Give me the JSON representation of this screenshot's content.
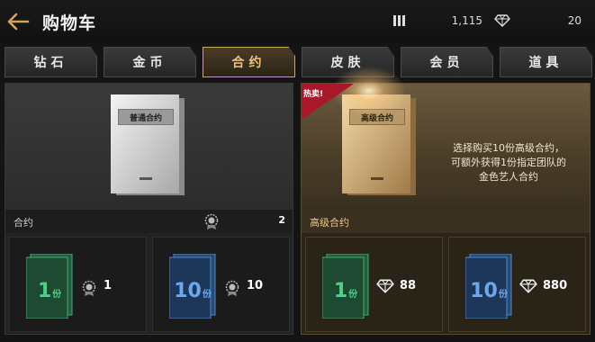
{
  "header": {
    "title": "购物车",
    "currency1_value": "1,115",
    "currency2_value": "20"
  },
  "tabs": [
    {
      "label": "钻石",
      "active": false
    },
    {
      "label": "金币",
      "active": false
    },
    {
      "label": "合约",
      "active": true
    },
    {
      "label": "皮肤",
      "active": false
    },
    {
      "label": "会员",
      "active": false
    },
    {
      "label": "道具",
      "active": false
    }
  ],
  "left_panel": {
    "card_label": "普通合约",
    "info_name": "合约",
    "owned_count": "2",
    "offers": [
      {
        "quantity": "1",
        "unit": "份",
        "price": "1",
        "currency": "medal-icon"
      },
      {
        "quantity": "10",
        "unit": "份",
        "price": "10",
        "currency": "medal-icon"
      }
    ]
  },
  "right_panel": {
    "badge": "热卖!",
    "card_label": "高级合约",
    "description": "选择购买10份高级合约，\n可额外获得1份指定团队的\n金色艺人合约",
    "info_name": "高级合约",
    "offers": [
      {
        "quantity": "1",
        "unit": "份",
        "price": "88",
        "currency": "diamond-icon"
      },
      {
        "quantity": "10",
        "unit": "份",
        "price": "880",
        "currency": "diamond-icon"
      }
    ]
  },
  "colors": {
    "accent_gold": "#d2a45e",
    "hot_red": "#a8182a",
    "pack_green": "#3fae73",
    "pack_blue": "#4a86d6"
  }
}
